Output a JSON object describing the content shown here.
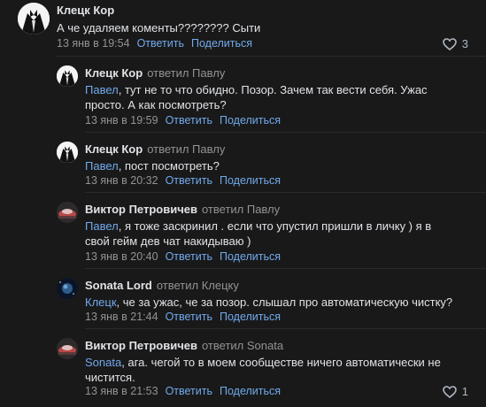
{
  "colors": {
    "background": "#19191a",
    "link": "#71aaeb",
    "muted": "#939393",
    "text": "#e1e3e6"
  },
  "comments": [
    {
      "author": "Клецк Кор",
      "text": "А че удаляем коменты???????? Сыти",
      "date": "13 янв в 19:54",
      "reply_label": "Ответить",
      "share_label": "Поделиться",
      "likes": "3",
      "avatar_icon": "tuxedo-avatar-icon"
    },
    {
      "author": "Клецк Кор",
      "replied": "ответил Павлу",
      "mention": "Павел",
      "text": ", тут не то что обидно. Позор. Зачем так вести себя. Ужас просто. А как посмотреть?",
      "date": "13 янв в 19:59",
      "reply_label": "Ответить",
      "share_label": "Поделиться",
      "avatar_icon": "tuxedo-avatar-icon"
    },
    {
      "author": "Клецк Кор",
      "replied": "ответил Павлу",
      "mention": "Павел",
      "text": ", пост посмотреть?",
      "date": "13 янв в 20:32",
      "reply_label": "Ответить",
      "share_label": "Поделиться",
      "avatar_icon": "tuxedo-avatar-icon"
    },
    {
      "author": "Виктор Петровичев",
      "replied": "ответил Павлу",
      "mention": "Павел",
      "text": ", я тоже заскринил . если что упустил пришли в личку ) я в свой гейм дев чат накидываю )",
      "date": "13 янв в 20:40",
      "reply_label": "Ответить",
      "share_label": "Поделиться",
      "avatar_icon": "car-avatar-icon"
    },
    {
      "author": "Sonata Lord",
      "replied": "ответил Клецку",
      "mention": "Клецк",
      "text": ", че за ужас, че за позор. слышал про автоматическую чистку?",
      "date": "13 янв в 21:44",
      "reply_label": "Ответить",
      "share_label": "Поделиться",
      "avatar_icon": "space-avatar-icon"
    },
    {
      "author": "Виктор Петровичев",
      "replied": "ответил Sonata",
      "mention": "Sonata",
      "text": ", ага. чегой то в моем сообществе ничего автоматически не чистится.",
      "date": "13 янв в 21:53",
      "reply_label": "Ответить",
      "share_label": "Поделиться",
      "likes": "1",
      "avatar_icon": "car-avatar-icon"
    }
  ]
}
